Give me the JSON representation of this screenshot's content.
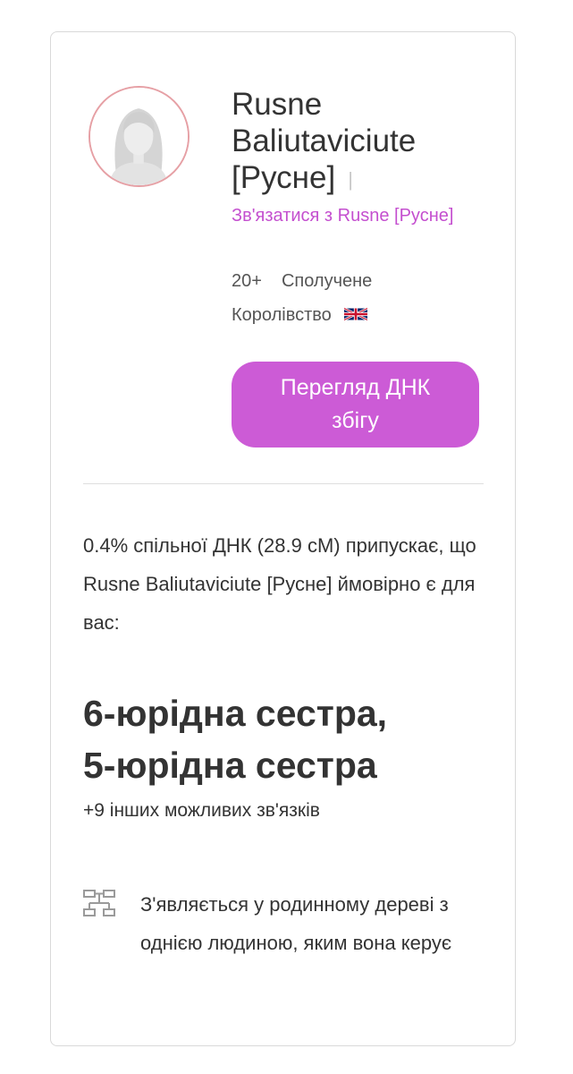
{
  "profile": {
    "name_line1": "Rusne",
    "name_line2": "Baliutaviciute",
    "name_line3": "[Русне]",
    "name_separator": "|",
    "contact_link": "Зв'язатися з Rusne [Русне]",
    "age": "20+",
    "location": "Сполучене Королівство",
    "flag_icon": "uk-flag-icon",
    "avatar_icon": "female-avatar-placeholder-icon"
  },
  "action": {
    "view_match_label": "Перегляд ДНК збігу"
  },
  "match": {
    "summary": "0.4% спільної ДНК (28.9 сМ) припускає, що Rusne Baliutaviciute [Русне] ймовірно є для вас:",
    "relationship_line1": "6-юрідна сестра,",
    "relationship_line2": "5-юрідна сестра",
    "more_relationships": "+9 інших можливих зв'язків"
  },
  "tree": {
    "icon": "family-tree-icon",
    "text": "З'являється у родинному дереві з однією людиною, яким вона керує"
  },
  "colors": {
    "accent": "#cc5bd6",
    "link": "#c44fcf",
    "avatar_ring": "#e6a0a5"
  }
}
